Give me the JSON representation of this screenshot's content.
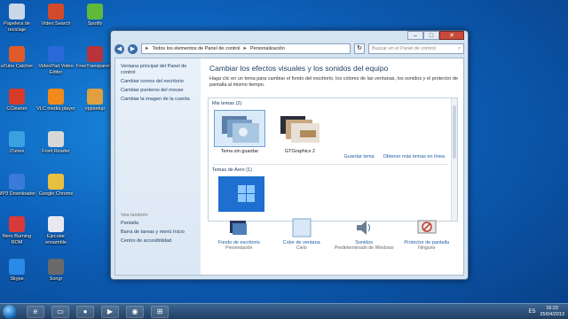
{
  "desktop_icons": [
    {
      "label": "Papelera de reciclaje",
      "color": "#c8d8e8"
    },
    {
      "label": "Video Search",
      "color": "#d24a2a"
    },
    {
      "label": "Spotify",
      "color": "#5fb93a"
    },
    {
      "label": "aTube Catcher",
      "color": "#e05a2a"
    },
    {
      "label": "VideoPad Video Editor",
      "color": "#2a6ad8"
    },
    {
      "label": "FreeTransparenc",
      "color": "#b8343a"
    },
    {
      "label": "CCleaner",
      "color": "#d83a2a"
    },
    {
      "label": "VLC media player",
      "color": "#f08a1a"
    },
    {
      "label": "vppsetup",
      "color": "#e0a040"
    },
    {
      "label": "iTunes",
      "color": "#3aa0e0"
    },
    {
      "label": "Foxit Reader",
      "color": "#d8d8d8"
    },
    {
      "label": "MP3 Downloader",
      "color": "#3a7ad8"
    },
    {
      "label": "Google Chrome",
      "color": "#e8c040"
    },
    {
      "label": "Nero Burning ROM",
      "color": "#d83a3a"
    },
    {
      "label": "Ejecutar ensamble",
      "color": "#e8e8f0"
    },
    {
      "label": "Skype",
      "color": "#2a8ae8"
    },
    {
      "label": "Songr",
      "color": "#6a6a6a"
    }
  ],
  "window": {
    "controls": {
      "minimize": "–",
      "maximize": "□",
      "close": "✕"
    },
    "address": {
      "back_icon": "◀",
      "forward_icon": "▶",
      "crumbs": [
        "Todos los elementos de Panel de control",
        "Personalización"
      ],
      "separator": "►",
      "refresh": "↻",
      "search_placeholder": "Buscar en el Panel de control",
      "search_icon": "⌕"
    },
    "left_pane": {
      "links": [
        "Ventana principal del Panel de control",
        "Cambiar iconos del escritorio",
        "Cambiar punteros del mouse",
        "Cambiar la imagen de la cuenta"
      ],
      "see_also_title": "Vea también",
      "see_also": [
        "Pantalla",
        "Barra de tareas y menú Inicio",
        "Centro de accesibilidad"
      ]
    },
    "main": {
      "title": "Cambiar los efectos visuales y los sonidos del equipo",
      "description": "Haga clic en un tema para cambiar el fondo del escritorio, los colores de las ventanas, los sonidos y el protector de pantalla al mismo tiempo.",
      "my_themes_label": "Mis temas (2)",
      "themes": [
        {
          "name": "Tema sin guardar",
          "selected": true
        },
        {
          "name": "GTGraphics 2",
          "selected": false
        }
      ],
      "save_theme": "Guardar tema",
      "get_more": "Obtener más temas en línea",
      "aero_label": "Temas de Aero (1)",
      "bottom_items": [
        {
          "name": "Fondo de escritorio",
          "value": "Presentación"
        },
        {
          "name": "Color de ventana",
          "value": "Cielo"
        },
        {
          "name": "Sonidos",
          "value": "Predeterminado de Windows"
        },
        {
          "name": "Protector de pantalla",
          "value": "Ninguno"
        }
      ]
    }
  },
  "taskbar": {
    "apps": [
      "e",
      "▭",
      "●",
      "▶",
      "◉",
      "⊞"
    ],
    "tray": {
      "lang": "ES",
      "time": "16:22",
      "date": "25/04/2013"
    }
  }
}
